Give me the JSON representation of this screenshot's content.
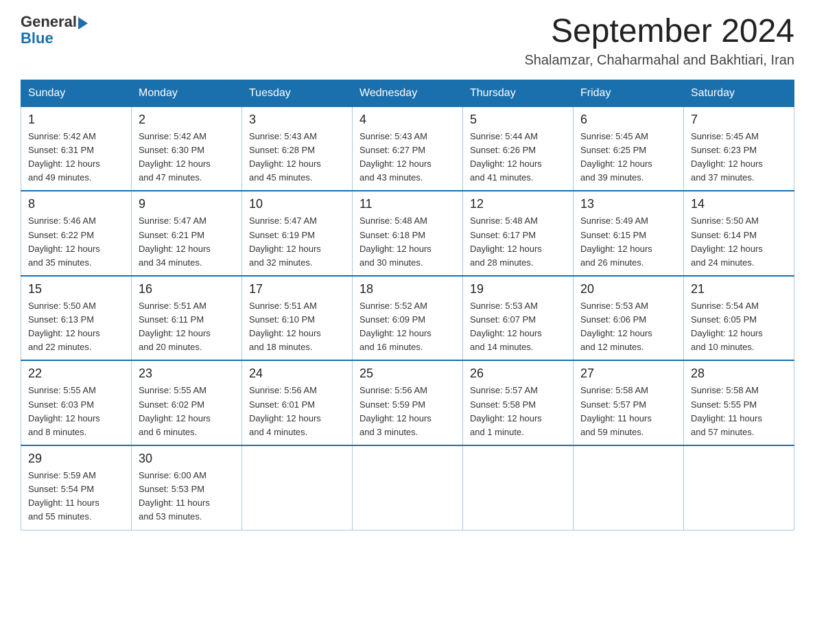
{
  "header": {
    "logo_general": "General",
    "logo_blue": "Blue",
    "title": "September 2024",
    "subtitle": "Shalamzar, Chaharmahal and Bakhtiari, Iran"
  },
  "days_of_week": [
    "Sunday",
    "Monday",
    "Tuesday",
    "Wednesday",
    "Thursday",
    "Friday",
    "Saturday"
  ],
  "weeks": [
    [
      {
        "date": "1",
        "sunrise": "5:42 AM",
        "sunset": "6:31 PM",
        "daylight": "12 hours and 49 minutes."
      },
      {
        "date": "2",
        "sunrise": "5:42 AM",
        "sunset": "6:30 PM",
        "daylight": "12 hours and 47 minutes."
      },
      {
        "date": "3",
        "sunrise": "5:43 AM",
        "sunset": "6:28 PM",
        "daylight": "12 hours and 45 minutes."
      },
      {
        "date": "4",
        "sunrise": "5:43 AM",
        "sunset": "6:27 PM",
        "daylight": "12 hours and 43 minutes."
      },
      {
        "date": "5",
        "sunrise": "5:44 AM",
        "sunset": "6:26 PM",
        "daylight": "12 hours and 41 minutes."
      },
      {
        "date": "6",
        "sunrise": "5:45 AM",
        "sunset": "6:25 PM",
        "daylight": "12 hours and 39 minutes."
      },
      {
        "date": "7",
        "sunrise": "5:45 AM",
        "sunset": "6:23 PM",
        "daylight": "12 hours and 37 minutes."
      }
    ],
    [
      {
        "date": "8",
        "sunrise": "5:46 AM",
        "sunset": "6:22 PM",
        "daylight": "12 hours and 35 minutes."
      },
      {
        "date": "9",
        "sunrise": "5:47 AM",
        "sunset": "6:21 PM",
        "daylight": "12 hours and 34 minutes."
      },
      {
        "date": "10",
        "sunrise": "5:47 AM",
        "sunset": "6:19 PM",
        "daylight": "12 hours and 32 minutes."
      },
      {
        "date": "11",
        "sunrise": "5:48 AM",
        "sunset": "6:18 PM",
        "daylight": "12 hours and 30 minutes."
      },
      {
        "date": "12",
        "sunrise": "5:48 AM",
        "sunset": "6:17 PM",
        "daylight": "12 hours and 28 minutes."
      },
      {
        "date": "13",
        "sunrise": "5:49 AM",
        "sunset": "6:15 PM",
        "daylight": "12 hours and 26 minutes."
      },
      {
        "date": "14",
        "sunrise": "5:50 AM",
        "sunset": "6:14 PM",
        "daylight": "12 hours and 24 minutes."
      }
    ],
    [
      {
        "date": "15",
        "sunrise": "5:50 AM",
        "sunset": "6:13 PM",
        "daylight": "12 hours and 22 minutes."
      },
      {
        "date": "16",
        "sunrise": "5:51 AM",
        "sunset": "6:11 PM",
        "daylight": "12 hours and 20 minutes."
      },
      {
        "date": "17",
        "sunrise": "5:51 AM",
        "sunset": "6:10 PM",
        "daylight": "12 hours and 18 minutes."
      },
      {
        "date": "18",
        "sunrise": "5:52 AM",
        "sunset": "6:09 PM",
        "daylight": "12 hours and 16 minutes."
      },
      {
        "date": "19",
        "sunrise": "5:53 AM",
        "sunset": "6:07 PM",
        "daylight": "12 hours and 14 minutes."
      },
      {
        "date": "20",
        "sunrise": "5:53 AM",
        "sunset": "6:06 PM",
        "daylight": "12 hours and 12 minutes."
      },
      {
        "date": "21",
        "sunrise": "5:54 AM",
        "sunset": "6:05 PM",
        "daylight": "12 hours and 10 minutes."
      }
    ],
    [
      {
        "date": "22",
        "sunrise": "5:55 AM",
        "sunset": "6:03 PM",
        "daylight": "12 hours and 8 minutes."
      },
      {
        "date": "23",
        "sunrise": "5:55 AM",
        "sunset": "6:02 PM",
        "daylight": "12 hours and 6 minutes."
      },
      {
        "date": "24",
        "sunrise": "5:56 AM",
        "sunset": "6:01 PM",
        "daylight": "12 hours and 4 minutes."
      },
      {
        "date": "25",
        "sunrise": "5:56 AM",
        "sunset": "5:59 PM",
        "daylight": "12 hours and 3 minutes."
      },
      {
        "date": "26",
        "sunrise": "5:57 AM",
        "sunset": "5:58 PM",
        "daylight": "12 hours and 1 minute."
      },
      {
        "date": "27",
        "sunrise": "5:58 AM",
        "sunset": "5:57 PM",
        "daylight": "11 hours and 59 minutes."
      },
      {
        "date": "28",
        "sunrise": "5:58 AM",
        "sunset": "5:55 PM",
        "daylight": "11 hours and 57 minutes."
      }
    ],
    [
      {
        "date": "29",
        "sunrise": "5:59 AM",
        "sunset": "5:54 PM",
        "daylight": "11 hours and 55 minutes."
      },
      {
        "date": "30",
        "sunrise": "6:00 AM",
        "sunset": "5:53 PM",
        "daylight": "11 hours and 53 minutes."
      },
      null,
      null,
      null,
      null,
      null
    ]
  ],
  "labels": {
    "sunrise": "Sunrise:",
    "sunset": "Sunset:",
    "daylight": "Daylight:"
  }
}
